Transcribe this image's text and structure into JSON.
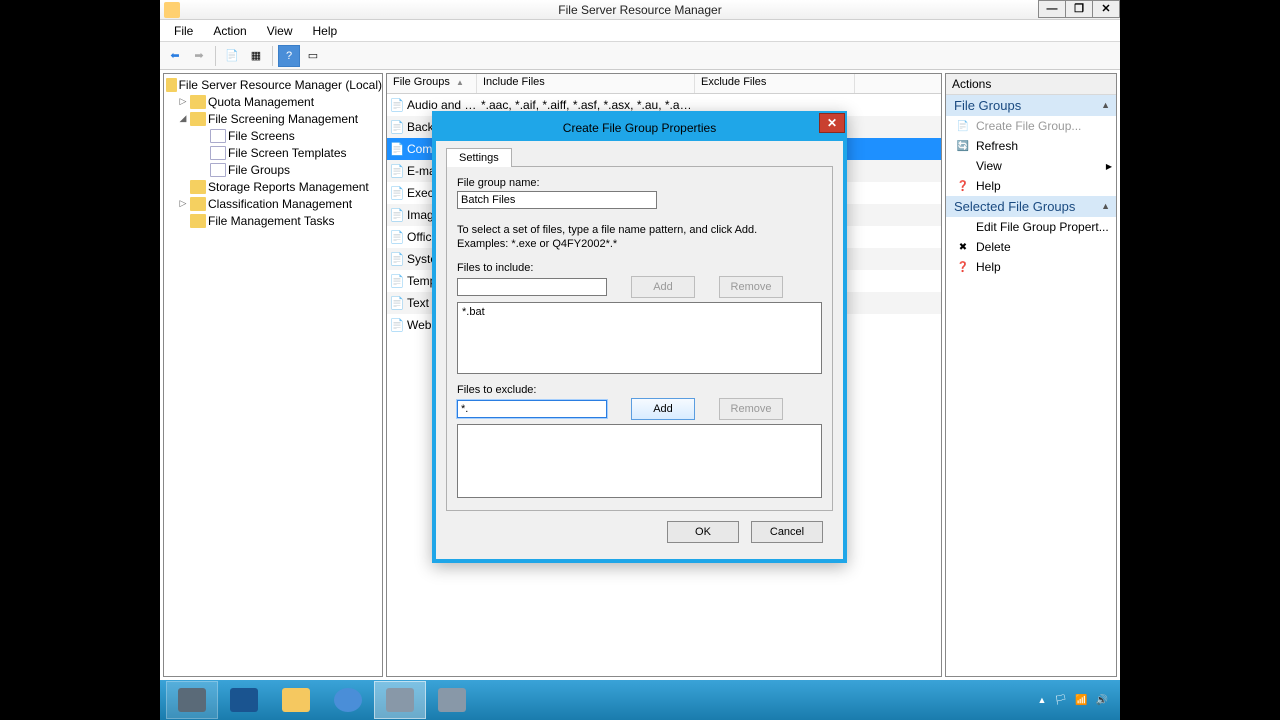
{
  "window": {
    "title": "File Server Resource Manager",
    "close_glyph": "✕"
  },
  "menu": {
    "file": "File",
    "action": "Action",
    "view": "View",
    "help": "Help"
  },
  "tree": {
    "root": "File Server Resource Manager (Local)",
    "items": [
      {
        "label": "Quota Management",
        "indent": 14,
        "expander": "▷"
      },
      {
        "label": "File Screening Management",
        "indent": 14,
        "expander": "◢"
      },
      {
        "label": "File Screens",
        "indent": 34,
        "expander": ""
      },
      {
        "label": "File Screen Templates",
        "indent": 34,
        "expander": ""
      },
      {
        "label": "File Groups",
        "indent": 34,
        "expander": ""
      },
      {
        "label": "Storage Reports Management",
        "indent": 14,
        "expander": ""
      },
      {
        "label": "Classification Management",
        "indent": 14,
        "expander": "▷"
      },
      {
        "label": "File Management Tasks",
        "indent": 14,
        "expander": ""
      }
    ]
  },
  "columns": {
    "c0": "File Groups",
    "sort": "▲",
    "c1": "Include Files",
    "c2": "Exclude Files"
  },
  "rows": [
    {
      "name": "Audio and Vid...",
      "include": "*.aac, *.aif, *.aiff, *.asf, *.asx, *.au, *.avi, *.f..."
    },
    {
      "name": "Back",
      "include": ""
    },
    {
      "name": "Com",
      "include": "",
      "selected": true
    },
    {
      "name": "E-ma",
      "include": ""
    },
    {
      "name": "Execu",
      "include": ""
    },
    {
      "name": "Imag",
      "include": ""
    },
    {
      "name": "Offic",
      "include": ""
    },
    {
      "name": "Syste",
      "include": ""
    },
    {
      "name": "Temp",
      "include": ""
    },
    {
      "name": "Text F",
      "include": ""
    },
    {
      "name": "Web",
      "include": ""
    }
  ],
  "actions": {
    "header": "Actions",
    "section1": "File Groups",
    "items1": [
      {
        "label": "Create File Group...",
        "disabled": true
      },
      {
        "label": "Refresh"
      },
      {
        "label": "View",
        "submenu": true
      },
      {
        "label": "Help"
      }
    ],
    "section2": "Selected File Groups",
    "items2": [
      {
        "label": "Edit File Group Propert..."
      },
      {
        "label": "Delete"
      },
      {
        "label": "Help"
      }
    ]
  },
  "dialog": {
    "title": "Create File Group Properties",
    "tab": "Settings",
    "name_label": "File group name:",
    "name_value": "Batch Files",
    "instr1": "To select a set of files, type a file name pattern, and click Add.",
    "instr2": "Examples: *.exe or Q4FY2002*.*",
    "include_label": "Files to include:",
    "include_input": "",
    "include_list": "*.bat",
    "exclude_label": "Files to exclude:",
    "exclude_input": "*.",
    "add": "Add",
    "remove": "Remove",
    "ok": "OK",
    "cancel": "Cancel"
  }
}
